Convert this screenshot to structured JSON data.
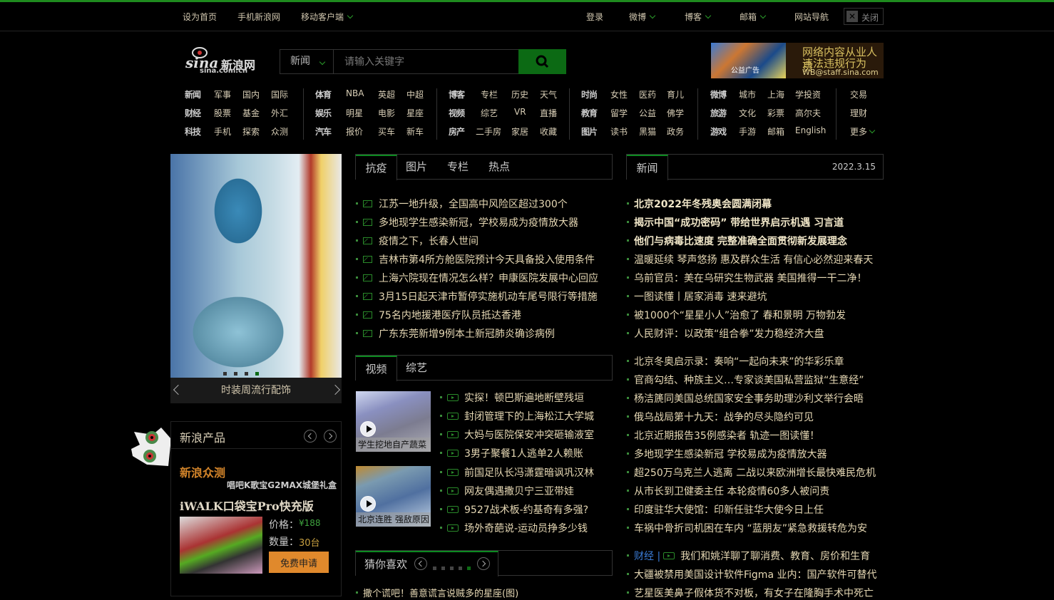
{
  "topbar": {
    "set_home": "设为首页",
    "mobile_sina": "手机新浪网",
    "mobile_client": "移动客户端",
    "login": "登录",
    "weibo": "微博",
    "blog": "博客",
    "mail": "邮箱",
    "site_nav": "网站导航",
    "close": "关闭"
  },
  "logo": {
    "text": "新浪网",
    "sub": "sina.com.cn",
    "mark": "sina"
  },
  "search": {
    "category": "新闻",
    "placeholder": "请输入关键字"
  },
  "ad": {
    "line1": "网络内容从业人员",
    "line2": "违法违规行为",
    "line3": "WB@staff.sina.com",
    "badge": "公益广告"
  },
  "nav": {
    "g1": [
      [
        "新闻",
        "军事",
        "国内",
        "国际"
      ],
      [
        "财经",
        "股票",
        "基金",
        "外汇"
      ],
      [
        "科技",
        "手机",
        "探索",
        "众测"
      ]
    ],
    "g2": [
      [
        "体育",
        "NBA",
        "英超",
        "中超"
      ],
      [
        "娱乐",
        "明星",
        "电影",
        "星座"
      ],
      [
        "汽车",
        "报价",
        "买车",
        "新车"
      ]
    ],
    "g3": [
      [
        "博客",
        "专栏",
        "历史",
        "天气"
      ],
      [
        "视频",
        "综艺",
        "VR",
        "直播"
      ],
      [
        "房产",
        "二手房",
        "家居",
        "收藏"
      ]
    ],
    "g4": [
      [
        "时尚",
        "女性",
        "医药",
        "育儿"
      ],
      [
        "教育",
        "留学",
        "公益",
        "佛学"
      ],
      [
        "图片",
        "读书",
        "黑猫",
        "政务"
      ]
    ],
    "g5": [
      [
        "微博",
        "城市",
        "上海",
        "学投资"
      ],
      [
        "旅游",
        "文化",
        "彩票",
        "高尔夫"
      ],
      [
        "游戏",
        "手游",
        "邮箱",
        "English"
      ]
    ],
    "g6": [
      "交易",
      "理财",
      "更多"
    ]
  },
  "slider": {
    "caption": "时装周流行配饰"
  },
  "products": {
    "title": "新浪产品",
    "name": "新浪众测",
    "promo": "唱吧K歌宝G2MAX城堡礼盒",
    "product": "iWALK口袋宝Pro快充版",
    "price_label": "价格：",
    "price_value": "¥188",
    "count_label": "数量：",
    "count_value": "30台",
    "apply": "免费申请"
  },
  "tabs_mid": [
    "抗疫",
    "图片",
    "专栏",
    "热点"
  ],
  "mid_news": [
    "江苏一地升级，全国高中风险区超过300个",
    "多地现学生感染新冠，学校易成为疫情放大器",
    "疫情之下，长春人世间",
    "吉林市第4所方舱医院预计今天具备投入使用条件",
    "上海六院现在情况怎么样？申康医院发展中心回应",
    "3月15日起天津市暂停实施机动车尾号限行等措施",
    "75名内地援港医疗队员抵达香港",
    "广东东莞新增9例本土新冠肺炎确诊病例"
  ],
  "tabs_video": [
    "视频",
    "综艺"
  ],
  "video_thumbs": [
    "学生挖地自产蔬菜",
    "北京连胜 强敌原因"
  ],
  "video_list": [
    "实探！顿巴斯遍地断壁残垣",
    "封闭管理下的上海松江大学城",
    "大妈与医院保安冲突砸输液室",
    "3男子聚餐1人逃单2人赖账",
    "前国足队长冯潇霆暗讽巩汉林",
    "网友偶遇撒贝宁三亚带娃",
    "9527战术板-约基奇有多强?",
    "场外奇葩说-运动员挣多少钱"
  ],
  "guess": {
    "title": "猜你喜欢",
    "first": "撒个谎吧！善意谎言说贼多的星座(图)"
  },
  "right": {
    "tab": "新闻",
    "date": "2022.3.15",
    "bold_news": [
      "北京2022年冬残奥会圆满闭幕",
      "揭示中国“成功密码” 带给世界启示机遇 习言道",
      "他们与病毒比速度 完整准确全面贯彻新发展理念"
    ],
    "news1": [
      "温暖延续 琴声悠扬 惠及群众生活 有信心必然迎来春天",
      "乌前官员：美在乌研究生物武器 美国推得一干二净！",
      "一图读懂丨居家消毒 速来避坑",
      "被1000个“星星小人”治愈了 春和景明 万物勃发",
      "人民财评：以政策“组合拳”发力稳经济大盘"
    ],
    "news2": [
      "北京冬奥启示录：奏响“一起向未来”的华彩乐章",
      "官商勾结、种族主义…专家谈美国私营监狱“生意经”",
      "杨洁篪同美国总统国家安全事务助理沙利文举行会晤",
      "俄乌战局第十九天：战争的尽头隐约可见",
      "北京近期报告35例感染者 轨迹一图读懂！",
      "多地现学生感染新冠 学校易成为疫情放大器",
      "超250万乌克兰人逃离 二战以来欧洲增长最快难民危机",
      "从市长到卫健委主任 本轮疫情60多人被问责",
      "印度驻华大使馆：印新任驻华大使今日上任",
      "车祸中骨折司机困在车内 “蓝朋友”紧急救援转危为安"
    ],
    "finance_tag": "财经 |",
    "finance_first": "我们和姚洋聊了聊消费、教育、房价和生育",
    "news3": [
      "大疆被禁用美国设计软件Figma 业内：国产软件可替代",
      "艺星医美鼻子假体货不对板，有女子在隆胸手术中死亡"
    ]
  }
}
